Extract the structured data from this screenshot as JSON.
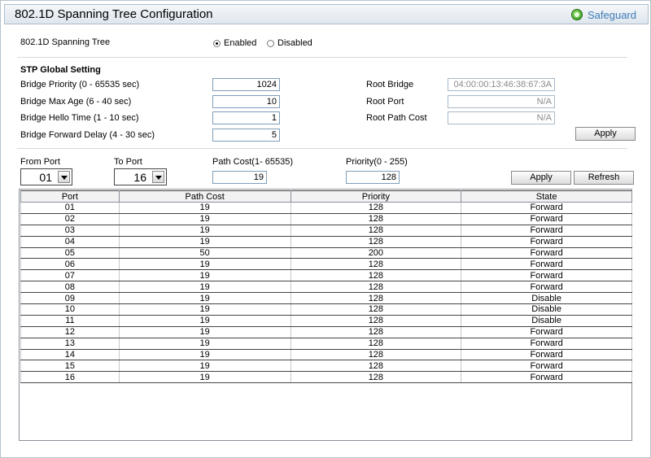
{
  "title": "802.1D Spanning Tree Configuration",
  "safeguard": "Safeguard",
  "stp": {
    "label": "802.1D Spanning Tree",
    "enabled_label": "Enabled",
    "disabled_label": "Disabled",
    "selected": "Enabled"
  },
  "global": {
    "heading": "STP Global Setting",
    "bridge_priority_label": "Bridge Priority (0 - 65535 sec)",
    "bridge_priority": "1024",
    "max_age_label": "Bridge Max Age (6 - 40 sec)",
    "max_age": "10",
    "hello_time_label": "Bridge Hello Time (1 - 10 sec)",
    "hello_time": "1",
    "forward_delay_label": "Bridge Forward Delay (4 - 30 sec)",
    "forward_delay": "5",
    "root_bridge_label": "Root Bridge",
    "root_bridge": "04:00:00:13:46:38:67:3A",
    "root_port_label": "Root Port",
    "root_port": "N/A",
    "root_path_cost_label": "Root Path Cost",
    "root_path_cost": "N/A",
    "apply_label": "Apply"
  },
  "port_settings": {
    "from_port_label": "From Port",
    "from_port": "01",
    "to_port_label": "To Port",
    "to_port": "16",
    "path_cost_label": "Path Cost(1- 65535)",
    "path_cost": "19",
    "priority_label": "Priority(0 - 255)",
    "priority": "128",
    "apply_label": "Apply",
    "refresh_label": "Refresh"
  },
  "table": {
    "headers": [
      "Port",
      "Path Cost",
      "Priority",
      "State"
    ],
    "rows": [
      [
        "01",
        "19",
        "128",
        "Forward"
      ],
      [
        "02",
        "19",
        "128",
        "Forward"
      ],
      [
        "03",
        "19",
        "128",
        "Forward"
      ],
      [
        "04",
        "19",
        "128",
        "Forward"
      ],
      [
        "05",
        "50",
        "200",
        "Forward"
      ],
      [
        "06",
        "19",
        "128",
        "Forward"
      ],
      [
        "07",
        "19",
        "128",
        "Forward"
      ],
      [
        "08",
        "19",
        "128",
        "Forward"
      ],
      [
        "09",
        "19",
        "128",
        "Disable"
      ],
      [
        "10",
        "19",
        "128",
        "Disable"
      ],
      [
        "11",
        "19",
        "128",
        "Disable"
      ],
      [
        "12",
        "19",
        "128",
        "Forward"
      ],
      [
        "13",
        "19",
        "128",
        "Forward"
      ],
      [
        "14",
        "19",
        "128",
        "Forward"
      ],
      [
        "15",
        "19",
        "128",
        "Forward"
      ],
      [
        "16",
        "19",
        "128",
        "Forward"
      ]
    ]
  }
}
